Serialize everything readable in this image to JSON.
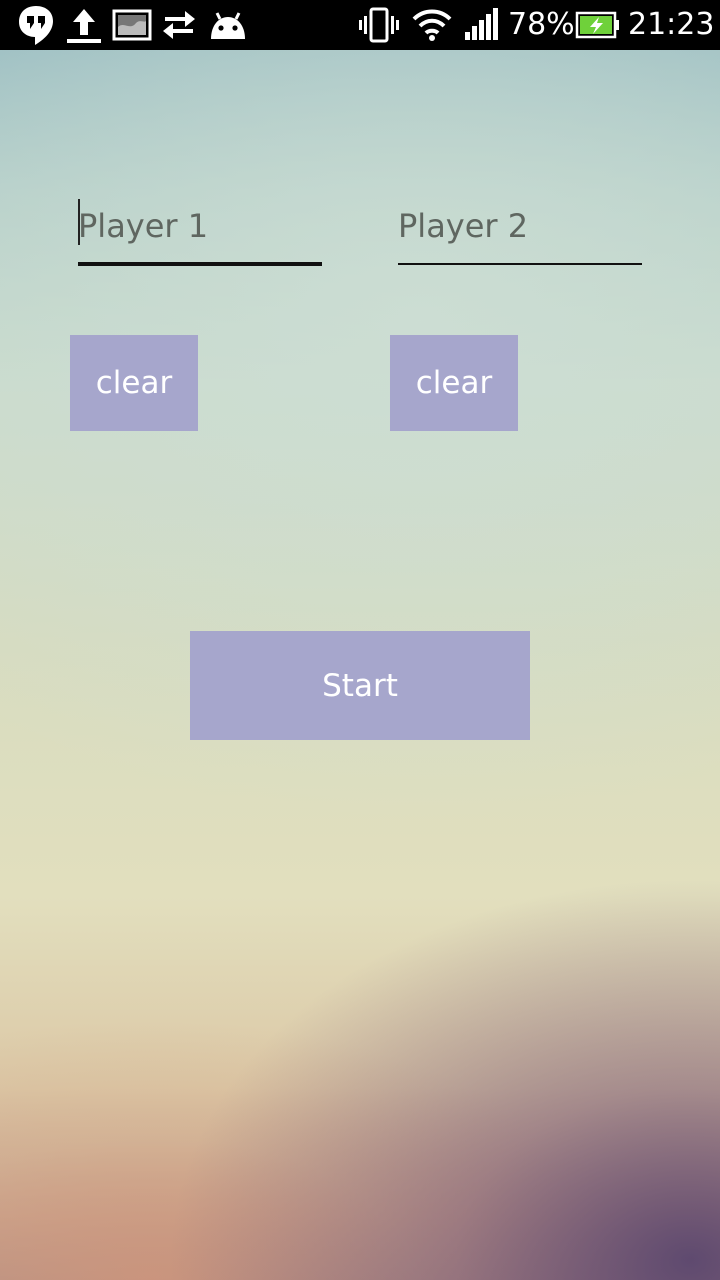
{
  "status_bar": {
    "icons": [
      "hangouts-icon",
      "upload-icon",
      "gallery-icon",
      "sync-icon",
      "android-icon",
      "vibrate-icon",
      "wifi-icon",
      "signal-icon",
      "battery-charging-icon"
    ],
    "battery_percent": "78%",
    "time": "21:23"
  },
  "players": {
    "player1": {
      "value": "",
      "placeholder": "Player 1",
      "clear_label": "clear"
    },
    "player2": {
      "value": "",
      "placeholder": "Player 2",
      "clear_label": "clear"
    }
  },
  "start_label": "Start",
  "colors": {
    "button_bg": "#a6a6cc",
    "button_text": "#ffffff",
    "status_bar_bg": "#000000",
    "battery_fill": "#6fd13a"
  }
}
